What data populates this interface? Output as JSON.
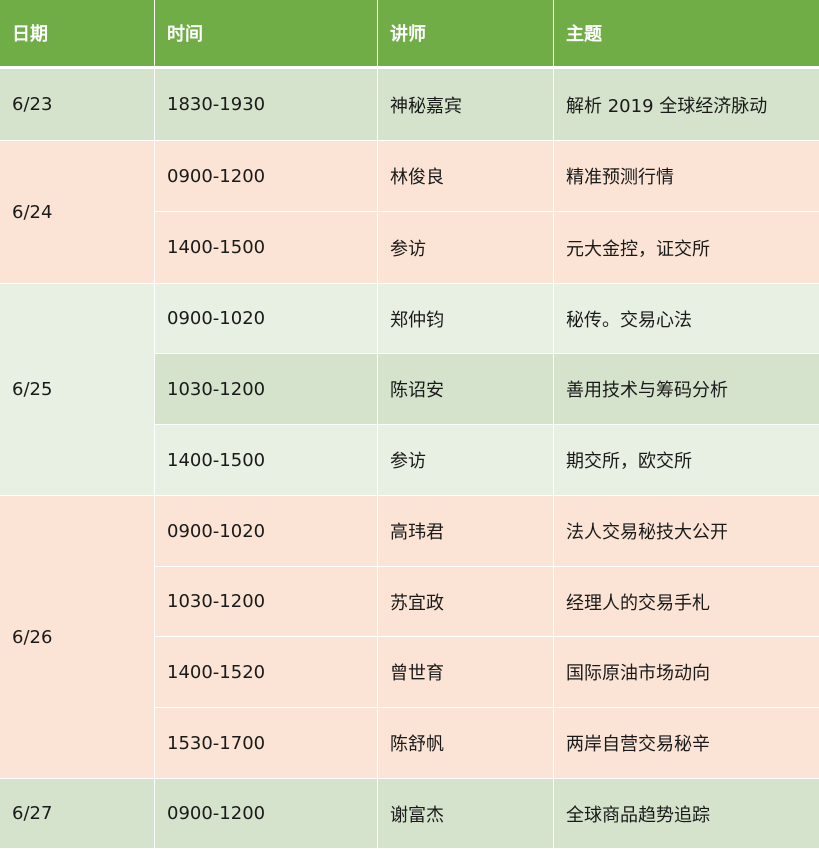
{
  "headers": [
    "日期",
    "时间",
    "讲师",
    "主题"
  ],
  "dates": [
    "6/23",
    "6/24",
    "6/25",
    "6/26",
    "6/27"
  ],
  "rows": [
    {
      "time": "1830-1930",
      "speaker": "神秘嘉宾",
      "topic": "解析 2019 全球经济脉动"
    },
    {
      "time": "0900-1200",
      "speaker": "林俊良",
      "topic": "精准预测行情"
    },
    {
      "time": "1400-1500",
      "speaker": "参访",
      "topic": "元大金控，证交所"
    },
    {
      "time": "0900-1020",
      "speaker": "郑仲钧",
      "topic": "秘传。交易心法"
    },
    {
      "time": "1030-1200",
      "speaker": "陈诏安",
      "topic": "善用技术与筹码分析"
    },
    {
      "time": "1400-1500",
      "speaker": "参访",
      "topic": "期交所，欧交所"
    },
    {
      "time": "0900-1020",
      "speaker": "高玮君",
      "topic": "法人交易秘技大公开"
    },
    {
      "time": "1030-1200",
      "speaker": "苏宜政",
      "topic": "经理人的交易手札"
    },
    {
      "time": "1400-1520",
      "speaker": "曾世育",
      "topic": "国际原油市场动向"
    },
    {
      "time": "1530-1700",
      "speaker": "陈舒帆",
      "topic": "两岸自营交易秘辛"
    },
    {
      "time": "0900-1200",
      "speaker": "谢富杰",
      "topic": "全球商品趋势追踪"
    }
  ],
  "colors": {
    "header": "#70ad47",
    "green_row": "#d5e3cc",
    "peach_row": "#fbe4d5",
    "light_green_row": "#e8efe3"
  }
}
